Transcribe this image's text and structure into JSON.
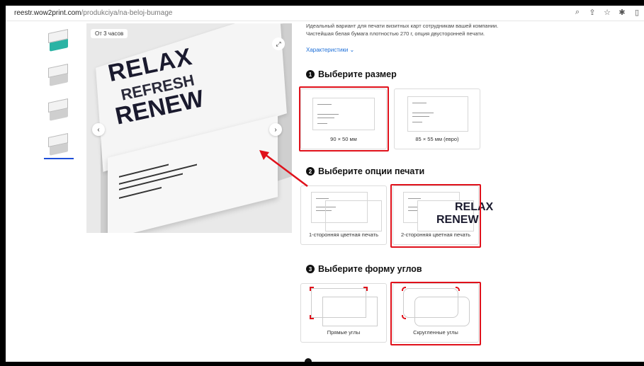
{
  "browser": {
    "url_host": "reestr.wow2print.com",
    "url_path": "/produkciya/na-beloj-bumage",
    "icons": [
      "zoom-icon",
      "share-icon",
      "star-icon",
      "extensions-icon",
      "sidebar-icon"
    ]
  },
  "gallery": {
    "badge": "От 3 часов",
    "hero_words": [
      "RELAX",
      "REFRESH",
      "RENEW"
    ]
  },
  "product": {
    "description_line1": "Идеальный вариант для печати визитных карт сотрудникам вашей компании.",
    "description_line2": "Чистейшая белая бумага плотностью 270 г, опция двусторонней печати.",
    "characteristics_link": "Характеристики ⌄"
  },
  "steps": [
    {
      "number": "1",
      "title": "Выберите размер",
      "options": [
        "90 × 50 мм",
        "85 × 55 мм (евро)"
      ],
      "selected": 0
    },
    {
      "number": "2",
      "title": "Выберите опции печати",
      "options": [
        "1-сторонняя цветная печать",
        "2-сторонняя цветная печать"
      ],
      "selected": 1
    },
    {
      "number": "3",
      "title": "Выберите форму углов",
      "options": [
        "Прямые углы",
        "Скругленные углы"
      ],
      "selected": 1
    }
  ],
  "colors": {
    "highlight": "#e0111b",
    "link": "#1d6fd8",
    "arrow": "#e0111b"
  }
}
